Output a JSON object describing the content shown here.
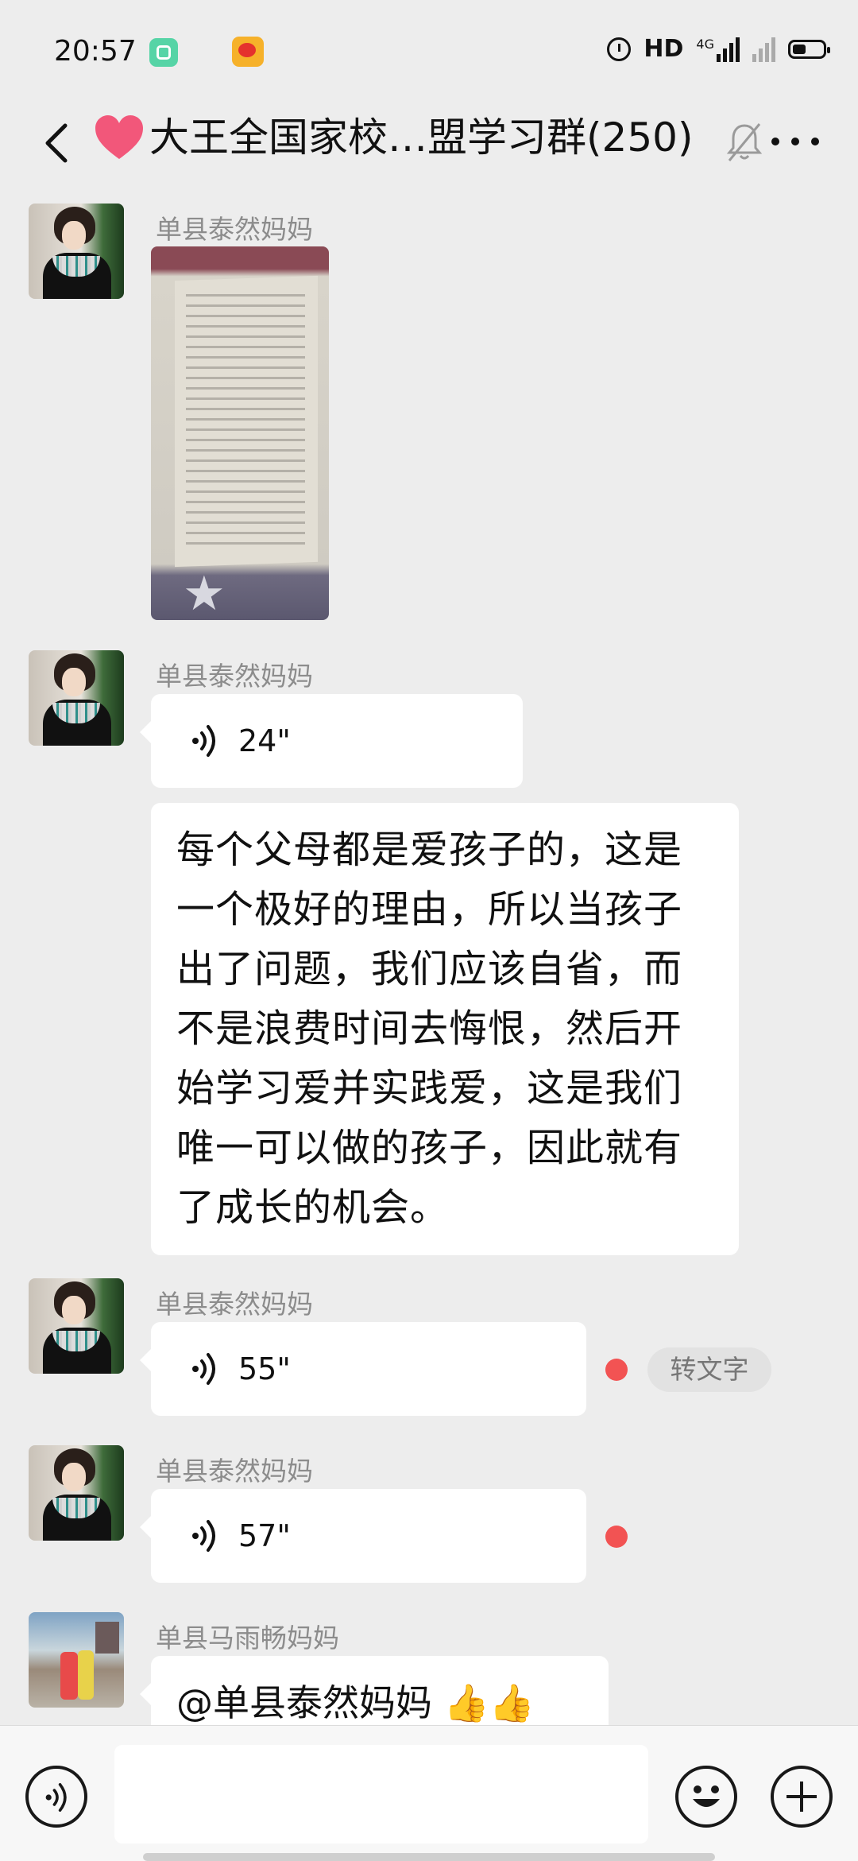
{
  "status_bar": {
    "time": "20:57",
    "network": "HD",
    "signal_label": "4G"
  },
  "header": {
    "title": "大王全国家校…盟学习群(250)",
    "back_icon": "chevron-left-icon",
    "mute_icon": "bell-muted-icon",
    "more_icon": "more-dots-icon"
  },
  "messages": [
    {
      "sender": "单县泰然妈妈",
      "type": "image"
    },
    {
      "sender": "单县泰然妈妈",
      "type": "voice",
      "duration": "24\""
    },
    {
      "type": "text",
      "text": "每个父母都是爱孩子的，这是一个极好的理由，所以当孩子出了问题，我们应该自省，而不是浪费时间去悔恨，然后开始学习爱并实践爱，这是我们唯一可以做的孩子，因此就有了成长的机会。"
    },
    {
      "sender": "单县泰然妈妈",
      "type": "voice",
      "duration": "55\"",
      "unread": true,
      "convert_label": "转文字"
    },
    {
      "sender": "单县泰然妈妈",
      "type": "voice",
      "duration": "57\"",
      "unread": true
    },
    {
      "sender": "单县马雨畅妈妈",
      "type": "text",
      "text": "@单县泰然妈妈 👍👍"
    }
  ],
  "input_bar": {
    "placeholder": "",
    "voice_icon": "voice-icon",
    "emoji_icon": "emoji-icon",
    "plus_icon": "plus-icon"
  },
  "colors": {
    "background": "#ededed",
    "bubble": "#ffffff",
    "unread_dot": "#f25353",
    "sender_name": "#8c8c8c"
  }
}
